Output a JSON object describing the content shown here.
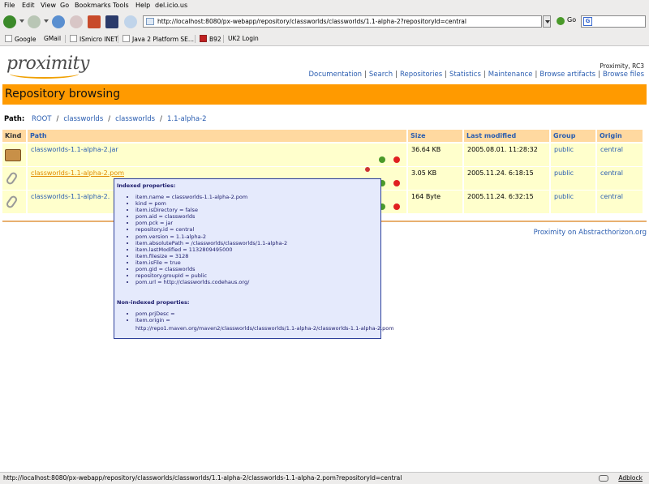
{
  "browser": {
    "menu": [
      "File",
      "Edit",
      "View",
      "Go",
      "Bookmarks",
      "Tools",
      "Help",
      "del.icio.us"
    ],
    "url": "http://localhost:8080/px-webapp/repository/classworlds/classworlds/1.1-alpha-2?repositoryId=central",
    "go_label": "Go",
    "search_value": "",
    "bookmarks": [
      "Google",
      "GMail",
      "ISmicro INET",
      "Java 2 Platform SE...",
      "B92",
      "UK2 Login"
    ],
    "status_text": "http://localhost:8080/px-webapp/repository/classworlds/classworlds/1.1-alpha-2/classworlds-1.1-alpha-2.pom?repositoryId=central",
    "adblock_label": "Adblock"
  },
  "page": {
    "logo_text": "proximity",
    "version": "Proximity, RC3",
    "nav": [
      "Documentation",
      "Search",
      "Repositories",
      "Statistics",
      "Maintenance",
      "Browse artifacts",
      "Browse files"
    ],
    "banner_title": "Repository browsing",
    "path_label": "Path:",
    "path": [
      "ROOT",
      "classworlds",
      "classworlds",
      "1.1-alpha-2"
    ],
    "table": {
      "headers": [
        "Kind",
        "Path",
        "Size",
        "Last modified",
        "Group",
        "Origin"
      ],
      "rows": [
        {
          "kind": "package",
          "name": "classworlds-1.1-alpha-2.jar",
          "size": "36.64 KB",
          "modified": "2005.08.01. 11:28:32",
          "group": "public",
          "origin": "central"
        },
        {
          "kind": "file",
          "name": "classworlds-1.1-alpha-2.pom",
          "size": "3.05 KB",
          "modified": "2005.11.24. 6:18:15",
          "group": "public",
          "origin": "central"
        },
        {
          "kind": "file",
          "name": "classworlds-1.1-alpha-2.",
          "size": "164 Byte",
          "modified": "2005.11.24. 6:32:15",
          "group": "public",
          "origin": "central"
        }
      ]
    },
    "footer_link": "Proximity on Abstracthorizon.org"
  },
  "popup": {
    "indexed_title": "Indexed properties:",
    "indexed": [
      "item.name = classworlds-1.1-alpha-2.pom",
      "kind = pom",
      "item.isDirectory = false",
      "pom.aid = classworlds",
      "pom.pck = jar",
      "repository.id = central",
      "pom.version = 1.1-alpha-2",
      "item.absolutePath = /classworlds/classworlds/1.1-alpha-2",
      "item.lastModified = 1132809495000",
      "item.filesize = 3128",
      "item.isFile = true",
      "pom.gid = classworlds",
      "repository.groupId = public",
      "pom.url = http://classworlds.codehaus.org/"
    ],
    "nonindexed_title": "Non-indexed properties:",
    "nonindexed": [
      "pom.prjDesc =",
      "item.origin =",
      "http://repo1.maven.org/maven2/classworlds/classworlds/1.1-alpha-2/classworlds-1.1-alpha-2.pom"
    ]
  },
  "colors": {
    "banner": "#ff9a00",
    "header_bg": "#ffd9a0",
    "row_bg": "#ffffcc",
    "link": "#2a5db0",
    "popup_bg": "#e5eafc"
  }
}
